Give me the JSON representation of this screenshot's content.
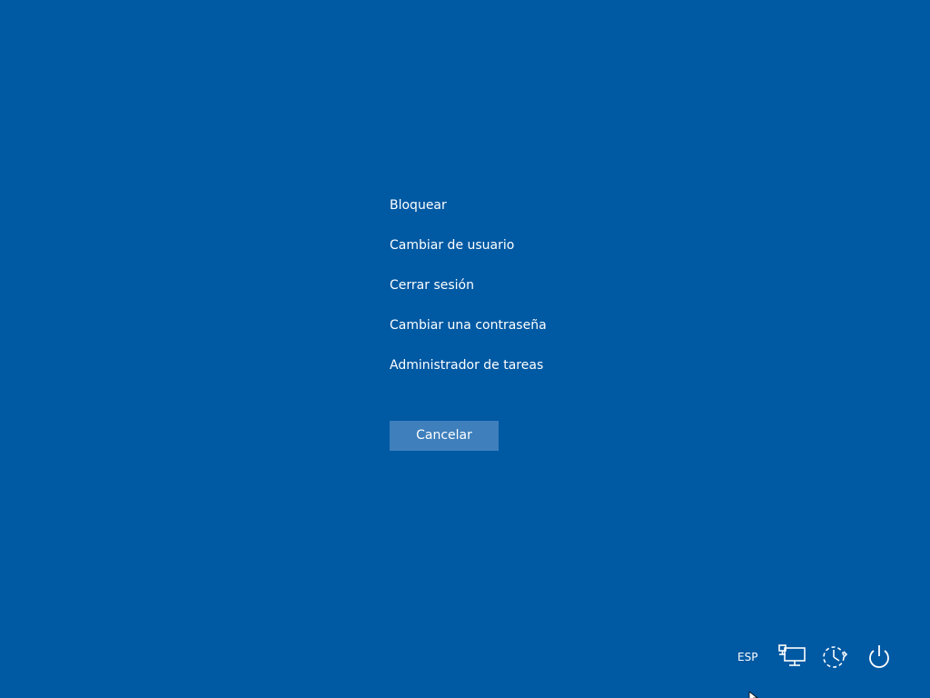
{
  "menu": {
    "items": [
      {
        "label": "Bloquear"
      },
      {
        "label": "Cambiar de usuario"
      },
      {
        "label": "Cerrar sesión"
      },
      {
        "label": "Cambiar una contraseña"
      },
      {
        "label": "Administrador de tareas"
      }
    ]
  },
  "cancel_button": {
    "label": "Cancelar"
  },
  "tray": {
    "language": "ESP",
    "icons": [
      "network-icon",
      "accessibility-icon",
      "power-icon"
    ]
  },
  "colors": {
    "background": "#0059a3",
    "button": "#3e7fbc",
    "text": "#ffffff"
  }
}
